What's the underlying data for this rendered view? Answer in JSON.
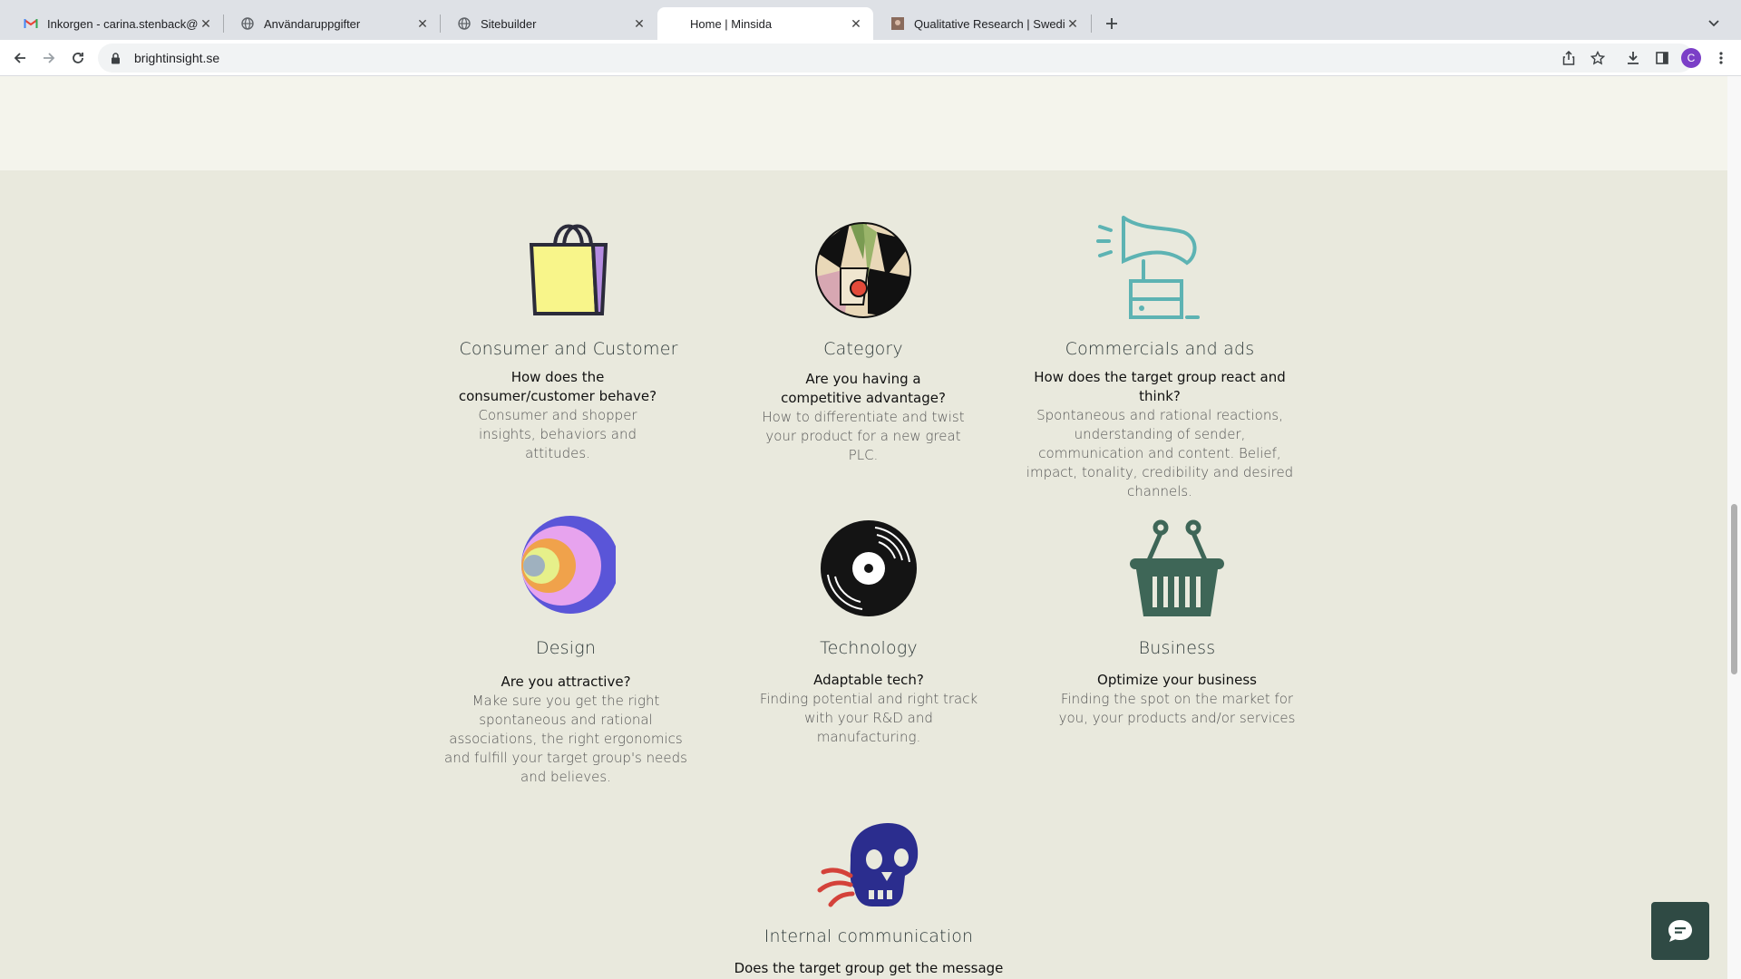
{
  "browser": {
    "tabs": [
      {
        "title": "Inkorgen - carina.stenback@g",
        "favicon": "gmail-icon"
      },
      {
        "title": "Användaruppgifter",
        "favicon": "globe-icon"
      },
      {
        "title": "Sitebuilder",
        "favicon": "globe-icon"
      },
      {
        "title": "Home | Minsida",
        "favicon": "none",
        "active": true
      },
      {
        "title": "Qualitative Research | Swedish",
        "favicon": "site-image-icon"
      }
    ],
    "url": "brightinsight.se",
    "profile_initial": "C"
  },
  "services": [
    {
      "icon": "shopping-bag-icon",
      "title": "Consumer and Customer",
      "question": "How does the consumer/customer behave?",
      "description": "Consumer and shopper insights, behaviors and attitudes."
    },
    {
      "icon": "leaf-circle-icon",
      "title": "Category",
      "question": "Are you having a competitive advantage?",
      "description": "How to differentiate and twist your product for a new great PLC."
    },
    {
      "icon": "gramophone-icon",
      "title": "Commercials and ads",
      "question": "How does the target group react and think?",
      "description": "Spontaneous and rational reactions, understanding of sender, communication and content. Belief, impact, tonality, credibility and desired channels."
    },
    {
      "icon": "concentric-circles-icon",
      "title": "Design",
      "question": "Are you attractive?",
      "description": "Make sure you get the right spontaneous and rational associations, the right ergonomics and fulfill your target group's needs and believes."
    },
    {
      "icon": "vinyl-record-icon",
      "title": "Technology",
      "question": "Adaptable tech?",
      "description": "Finding potential and right track with your R&D and manufacturing."
    },
    {
      "icon": "shopping-basket-icon",
      "title": "Business",
      "question": "Optimize your business",
      "description": "Finding the spot on the market for you, your products and/or services"
    },
    {
      "icon": "skull-icon",
      "title": "Internal communication",
      "question": "Does the target group get the message and",
      "description": ""
    }
  ],
  "colors": {
    "page_bg": "#e9e9dd",
    "top_band": "#f4f4ec",
    "chat_button": "#2f4a44"
  }
}
